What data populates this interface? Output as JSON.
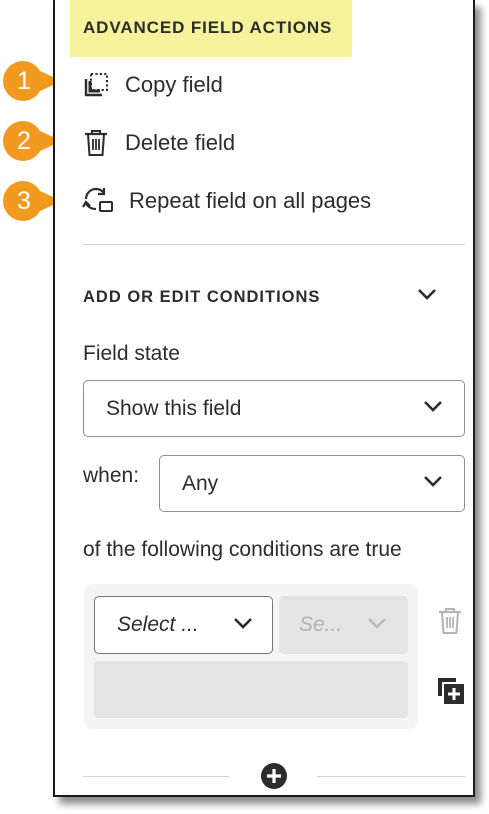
{
  "advanced": {
    "header": "ADVANCED FIELD ACTIONS",
    "actions": [
      {
        "label": "Copy field",
        "icon": "copy-icon",
        "badge": "1"
      },
      {
        "label": "Delete field",
        "icon": "trash-icon",
        "badge": "2"
      },
      {
        "label": "Repeat field on all pages",
        "icon": "repeat-icon",
        "badge": "3"
      }
    ]
  },
  "conditions": {
    "header": "ADD OR EDIT CONDITIONS",
    "field_state_label": "Field state",
    "field_state_value": "Show this field",
    "when_label": "when:",
    "when_value": "Any",
    "following_text": "of the following conditions are true",
    "condition_field_placeholder": "Select ...",
    "condition_operator_placeholder": "Se..."
  },
  "colors": {
    "badge": "#f29a1f",
    "header_highlight": "#f4f39c"
  }
}
